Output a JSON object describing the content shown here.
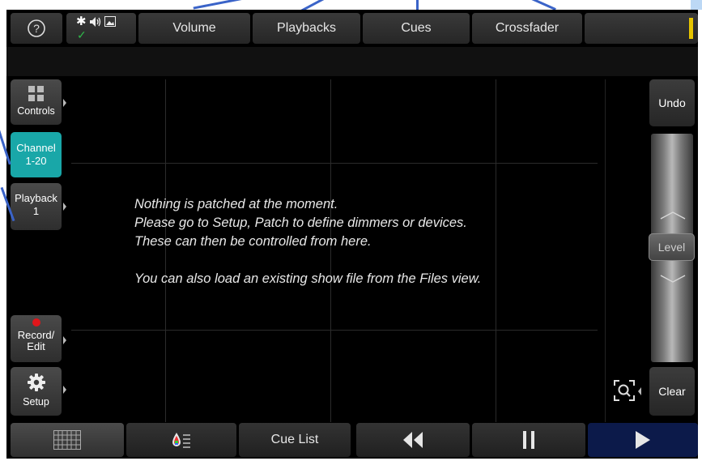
{
  "toolbar": {
    "help_icon": "help-circle-icon",
    "status_icons": [
      "brightness-icon",
      "speaker-icon",
      "image-icon"
    ],
    "status_check": "✓",
    "tabs": [
      {
        "label": "Volume"
      },
      {
        "label": "Playbacks"
      },
      {
        "label": "Cues"
      },
      {
        "label": "Crossfader"
      }
    ],
    "status_indicator_color": "#e6c400"
  },
  "sidebar": {
    "items": [
      {
        "label": "Controls",
        "icon": "grid-icon"
      },
      {
        "line1": "Channel",
        "line2": "1-20"
      },
      {
        "line1": "Playback",
        "line2": "1"
      },
      {
        "line1": "Record/",
        "line2": "Edit",
        "icon": "record-dot-icon"
      },
      {
        "label": "Setup",
        "icon": "gear-icon"
      }
    ],
    "active_color": "#19a7a8"
  },
  "main": {
    "message_lines": [
      "Nothing is patched at the moment.",
      "Please go to Setup, Patch to define dimmers or devices.",
      "These can then be controlled from here.",
      "You can also load an existing show file from the Files view."
    ]
  },
  "right_panel": {
    "undo_label": "Undo",
    "level_label": "Level",
    "clear_label": "Clear",
    "zoom_icon": "zoom-fit-icon"
  },
  "bottom_bar": {
    "grid_icon": "grid-view-icon",
    "color_icon": "color-palette-icon",
    "cue_list_label": "Cue List",
    "rewind_icon": "rewind-icon",
    "pause_icon": "pause-icon",
    "play_icon": "play-icon",
    "play_bg": "#0c1a4a"
  }
}
